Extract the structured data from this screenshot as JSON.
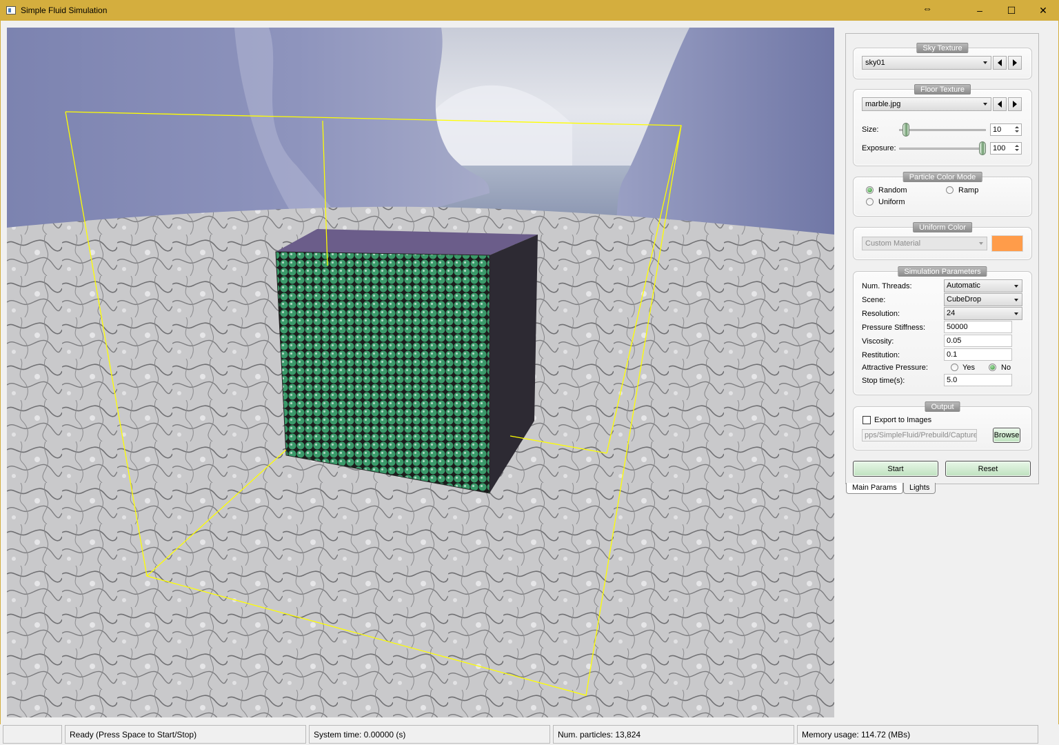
{
  "window": {
    "title": "Simple Fluid Simulation"
  },
  "panel": {
    "sky_texture": {
      "title": "Sky Texture",
      "value": "sky01"
    },
    "floor_texture": {
      "title": "Floor Texture",
      "value": "marble.jpg",
      "size_label": "Size:",
      "size_value": "10",
      "size_level": 0.04,
      "exposure_label": "Exposure:",
      "exposure_value": "100",
      "exposure_level": 1.0
    },
    "particle_color_mode": {
      "title": "Particle Color Mode",
      "options": [
        "Random",
        "Ramp",
        "Uniform"
      ],
      "selected": "Random"
    },
    "uniform_color": {
      "title": "Uniform Color",
      "material": "Custom Material",
      "color": "#ff9c4a"
    },
    "simulation": {
      "title": "Simulation Parameters",
      "num_threads_label": "Num. Threads:",
      "num_threads": "Automatic",
      "scene_label": "Scene:",
      "scene": "CubeDrop",
      "resolution_label": "Resolution:",
      "resolution": "24",
      "pressure_label": "Pressure Stiffness:",
      "pressure": "50000",
      "viscosity_label": "Viscosity:",
      "viscosity": "0.05",
      "restitution_label": "Restitution:",
      "restitution": "0.1",
      "attractive_label": "Attractive Pressure:",
      "attractive_yes": "Yes",
      "attractive_no": "No",
      "attractive_selected": "No",
      "stop_time_label": "Stop time(s):",
      "stop_time": "5.0"
    },
    "output": {
      "title": "Output",
      "export_label": "Export to Images",
      "export_checked": false,
      "path": "pps/SimpleFluid/Prebuild/Capture/",
      "browse_label": "Browse"
    },
    "start_label": "Start",
    "reset_label": "Reset",
    "tabs": [
      "Main Params",
      "Lights"
    ]
  },
  "status": {
    "ready": "Ready (Press Space to Start/Stop)",
    "system_time": "System time: 0.00000 (s)",
    "num_particles": "Num. particles: 13,824",
    "memory": "Memory usage: 114.72 (MBs)"
  },
  "colors": {
    "title_bar": "#d4ae3e",
    "bounding_box": "#ffff00",
    "accent_green": "#bfe2bf"
  }
}
